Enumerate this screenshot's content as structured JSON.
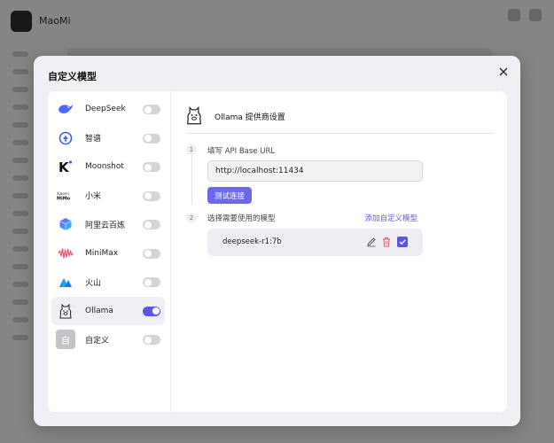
{
  "background_app": {
    "title": "MaoMi"
  },
  "dialog": {
    "title": "自定义模型"
  },
  "providers": [
    {
      "name": "DeepSeek",
      "icon": "deepseek-whale-icon",
      "enabled": false
    },
    {
      "name": "智谱",
      "icon": "zhipu-icon",
      "enabled": false
    },
    {
      "name": "Moonshot",
      "icon": "moonshot-k-icon",
      "enabled": false
    },
    {
      "name": "小米",
      "icon": "xiaomi-mimo-icon",
      "logo_text": "Xiaomi MiMo",
      "enabled": false
    },
    {
      "name": "阿里云百炼",
      "icon": "bailian-cube-icon",
      "enabled": false
    },
    {
      "name": "MiniMax",
      "icon": "minimax-wave-icon",
      "enabled": false
    },
    {
      "name": "火山",
      "icon": "volcano-mountain-icon",
      "enabled": false
    },
    {
      "name": "Ollama",
      "icon": "ollama-llama-icon",
      "enabled": true,
      "selected": true
    },
    {
      "name": "自定义",
      "icon": "custom-provider-icon",
      "logo_text": "自",
      "enabled": false
    }
  ],
  "settings": {
    "title": "Ollama 提供商设置",
    "step1": {
      "number": "1",
      "label": "填写 API Base URL",
      "input_value": "http://localhost:11434",
      "button_label": "测试连接"
    },
    "step2": {
      "number": "2",
      "label": "选择需要使用的模型",
      "add_link": "添加自定义模型"
    },
    "models": [
      {
        "name": "deepseek-r1:7b",
        "checked": true
      }
    ]
  },
  "colors": {
    "accent": "#5b57e0",
    "button": "#6c68ec",
    "toggle_off": "#d5d5d9",
    "delete": "#e05555"
  }
}
